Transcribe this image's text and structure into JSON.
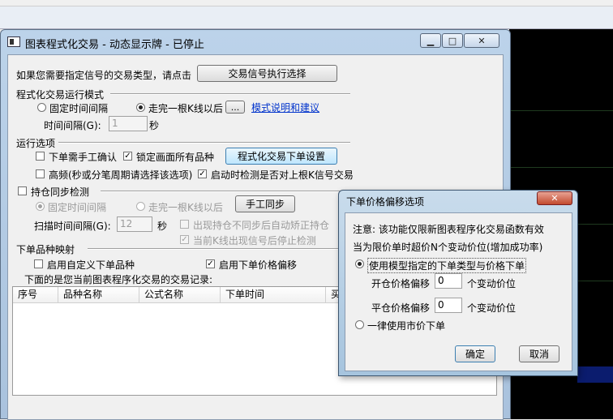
{
  "main_window": {
    "title": "图表程式化交易 - 动态显示牌 - 已停止",
    "intro_text": "如果您需要指定信号的交易类型，请点击",
    "signal_button": "交易信号执行选择",
    "mode_section": {
      "heading": "程式化交易运行模式",
      "fixed_interval_label": "固定时间间隔",
      "after_bar_label": "走完一根K线以后",
      "more_button": "...",
      "help_link": "模式说明和建议",
      "interval_label": "时间间隔(G):",
      "interval_value": "1",
      "interval_unit": "秒"
    },
    "run_options": {
      "heading": "运行选项",
      "manual_confirm_label": "下单需手工确认",
      "manual_confirm_checked": false,
      "lock_all_label": "锁定画面所有品种",
      "lock_all_checked": true,
      "order_settings_button": "程式化交易下单设置",
      "high_freq_label": "高频(秒或分笔周期请选择该选项)",
      "high_freq_checked": false,
      "check_prev_label": "启动时检测是否对上根K信号交易",
      "check_prev_checked": true
    },
    "position_sync": {
      "heading": "持仓同步检测",
      "checked": false,
      "fixed_interval_label": "固定时间间隔",
      "after_bar_label": "走完一根K线以后",
      "manual_sync_button": "手工同步",
      "scan_interval_label": "扫描时间间隔(G):",
      "scan_interval_value": "12",
      "scan_interval_unit": "秒",
      "auto_correct_label": "出现持仓不同步后自动矫正持仓",
      "stop_on_signal_label": "当前K线出现信号后停止检测"
    },
    "symbol_map": {
      "heading": "下单品种映射",
      "custom_symbol_label": "启用自定义下单品种",
      "custom_symbol_checked": false,
      "price_offset_label": "启用下单价格偏移",
      "price_offset_checked": true,
      "records_caption": "下面的是您当前图表程序化交易的交易记录:"
    },
    "table_columns": [
      "序号",
      "品种名称",
      "公式名称",
      "下单时间",
      "买"
    ]
  },
  "dialog": {
    "title": "下单价格偏移选项",
    "close_glyph": "✕",
    "note_line1": "注意: 该功能仅限新图表程序化交易函数有效",
    "note_line2": "当为限价单时超价N个变动价位(增加成功率)",
    "use_model_label": "使用模型指定的下单类型与价格下单",
    "open_offset_label": "开仓价格偏移",
    "open_offset_value": "0",
    "open_offset_unit": "个变动价位",
    "close_offset_label": "平仓价格偏移",
    "close_offset_value": "0",
    "close_offset_unit": "个变动价位",
    "market_label": "一律使用市价下单",
    "ok_button": "确定",
    "cancel_button": "取消"
  },
  "colors": {
    "title_gradient_top": "#bcd3ea",
    "close_button": "#c24a2e",
    "link": "#0033cc",
    "chart_background": "#000000"
  }
}
